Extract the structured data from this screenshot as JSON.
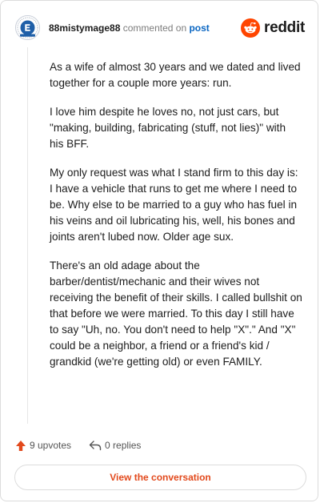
{
  "header": {
    "username": "88mistymage88",
    "action_text": "commented on",
    "post_link": "post",
    "brand": "reddit"
  },
  "comment": {
    "paragraphs": [
      "As a wife of almost 30 years and we dated and lived together for a couple more years: run.",
      "I love him despite he loves no, not just cars, but \"making, building, fabricating (stuff, not lies)\" with his BFF.",
      "My only request was what I stand firm to this day is: I have a vehicle that runs to get me where I need to be. Why else to be married to a guy who has fuel in his veins and oil lubricating his, well, his bones and joints aren't lubed now. Older age sux.",
      "There's an old adage about the barber/dentist/mechanic and their wives not receiving the benefit of their skills. I called bullshit on that before we were married. To this day I still have to say \"Uh, no. You don't need to help \"X\".\" And \"X\" could be a neighbor, a friend or a friend's kid / grandkid (we're getting old) or even FAMILY."
    ]
  },
  "footer": {
    "upvotes": "9 upvotes",
    "replies": "0 replies"
  },
  "cta": {
    "label": "View the conversation"
  },
  "icons": {
    "upvote": "upvote-arrow-icon",
    "reply": "reply-arrow-icon",
    "brand_logo": "reddit-snoo-icon",
    "avatar": "community-avatar-icon"
  },
  "colors": {
    "upvote": "#e2491c",
    "link": "#0a66c2",
    "cta_text": "#e2491c",
    "reddit_orange": "#ff4500"
  }
}
